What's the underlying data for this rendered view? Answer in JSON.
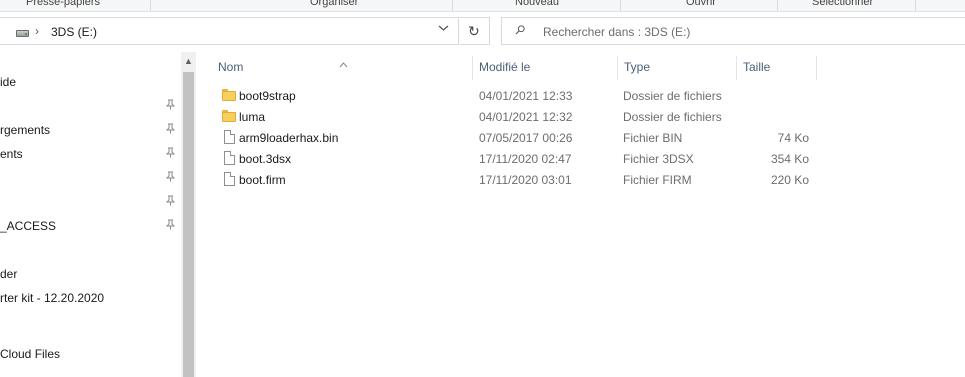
{
  "ribbon": {
    "groups": [
      "Presse-papiers",
      "Organiser",
      "Nouveau",
      "Ouvrir",
      "Sélectionner"
    ]
  },
  "address_bar": {
    "path": "3DS (E:)",
    "drive_icon": "drive-icon",
    "chevron": "›",
    "dropdown": "⌄",
    "refresh": "↻"
  },
  "search": {
    "placeholder": "Rechercher dans : 3DS (E:)"
  },
  "nav": {
    "items": [
      {
        "label": "ide",
        "pinned": false
      },
      {
        "label": "",
        "pinned": true
      },
      {
        "label": "rgements",
        "pinned": true
      },
      {
        "label": "ents",
        "pinned": true
      },
      {
        "label": "",
        "pinned": true
      },
      {
        "label": "",
        "pinned": true
      },
      {
        "label": "_ACCESS",
        "pinned": true
      },
      {
        "label": "",
        "pinned": false
      },
      {
        "label": "der",
        "pinned": false
      },
      {
        "label": "rter kit - 12.20.2020",
        "pinned": false
      },
      {
        "label": "",
        "pinned": false
      },
      {
        "label": "Cloud Files",
        "pinned": false
      }
    ],
    "pin_glyph": "📌",
    "scroll_up": "▲"
  },
  "columns": {
    "name": "Nom",
    "modified": "Modifié le",
    "type": "Type",
    "size": "Taille",
    "sort_caret": "^"
  },
  "files": [
    {
      "name": "boot9strap",
      "modified": "04/01/2021 12:33",
      "type": "Dossier de fichiers",
      "size": "",
      "icon": "folder-icon"
    },
    {
      "name": "luma",
      "modified": "04/01/2021 12:32",
      "type": "Dossier de fichiers",
      "size": "",
      "icon": "folder-icon"
    },
    {
      "name": "arm9loaderhax.bin",
      "modified": "07/05/2017 00:26",
      "type": "Fichier BIN",
      "size": "74 Ko",
      "icon": "file-icon"
    },
    {
      "name": "boot.3dsx",
      "modified": "17/11/2020 02:47",
      "type": "Fichier 3DSX",
      "size": "354 Ko",
      "icon": "file-icon"
    },
    {
      "name": "boot.firm",
      "modified": "17/11/2020 03:01",
      "type": "Fichier FIRM",
      "size": "220 Ko",
      "icon": "file-icon"
    }
  ]
}
